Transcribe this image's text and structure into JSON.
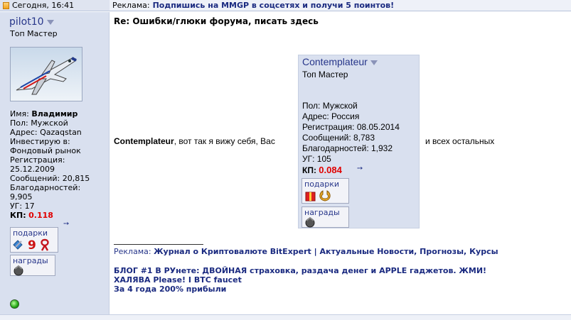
{
  "topbar": {
    "date": "Сегодня, 16:41",
    "ad_prefix": "Реклама:",
    "ad_link": "Подпишись на MMGP в соцсетях и получи 5 поинтов!"
  },
  "author": {
    "username": "pilot10",
    "rank": "Топ Мастер",
    "name_label": "Имя:",
    "name": "Владимир",
    "gender": "Пол: Мужской",
    "address": "Адрес: Qazaqstan",
    "invests_label": "Инвестирую в:",
    "invests": "Фондовый рынок",
    "reg_label": "Регистрация:",
    "reg": "25.12.2009",
    "posts": "Сообщений: 20,815",
    "thanks_label": "Благодарностей:",
    "thanks": "9,905",
    "ug": "УГ: 17",
    "kp_label": "КП:",
    "kp": "0.118",
    "gifts_title": "подарки",
    "awards_title": "награды"
  },
  "post": {
    "title": "Re: Ошибки/глюки форума, писать здесь",
    "mention": "Contemplateur",
    "text_before": ", вот так я вижу себя, Вас",
    "text_after": "и всех остальных"
  },
  "quoted_user": {
    "username": "Contemplateur",
    "rank": "Топ Мастер",
    "gender": "Пол: Мужской",
    "address": "Адрес: Россия",
    "reg": "Регистрация: 08.05.2014",
    "posts": "Сообщений: 8,783",
    "thanks": "Благодарностей: 1,932",
    "ug": "УГ: 105",
    "kp_label": "КП:",
    "kp": "0.084",
    "gifts_title": "подарки",
    "awards_title": "награды"
  },
  "signature": {
    "ad_label": "Реклама:",
    "ad_link": "Журнал о Криптовалюте BitExpert | Актуальные Новости, Прогнозы, Курсы",
    "line1": "БЛОГ #1 В РУнете: ДВОЙНАЯ страховка, раздача денег и APPLE гаджетов. ЖМИ!",
    "line2": "ХАЛЯВА Please! I BTC faucet",
    "line3": "За 4 года 200% прибыли"
  },
  "colors": {
    "link": "#1a2a80",
    "username": "#27368a",
    "kp_value": "#e00000",
    "sidebar_bg": "#d9e0ef"
  }
}
